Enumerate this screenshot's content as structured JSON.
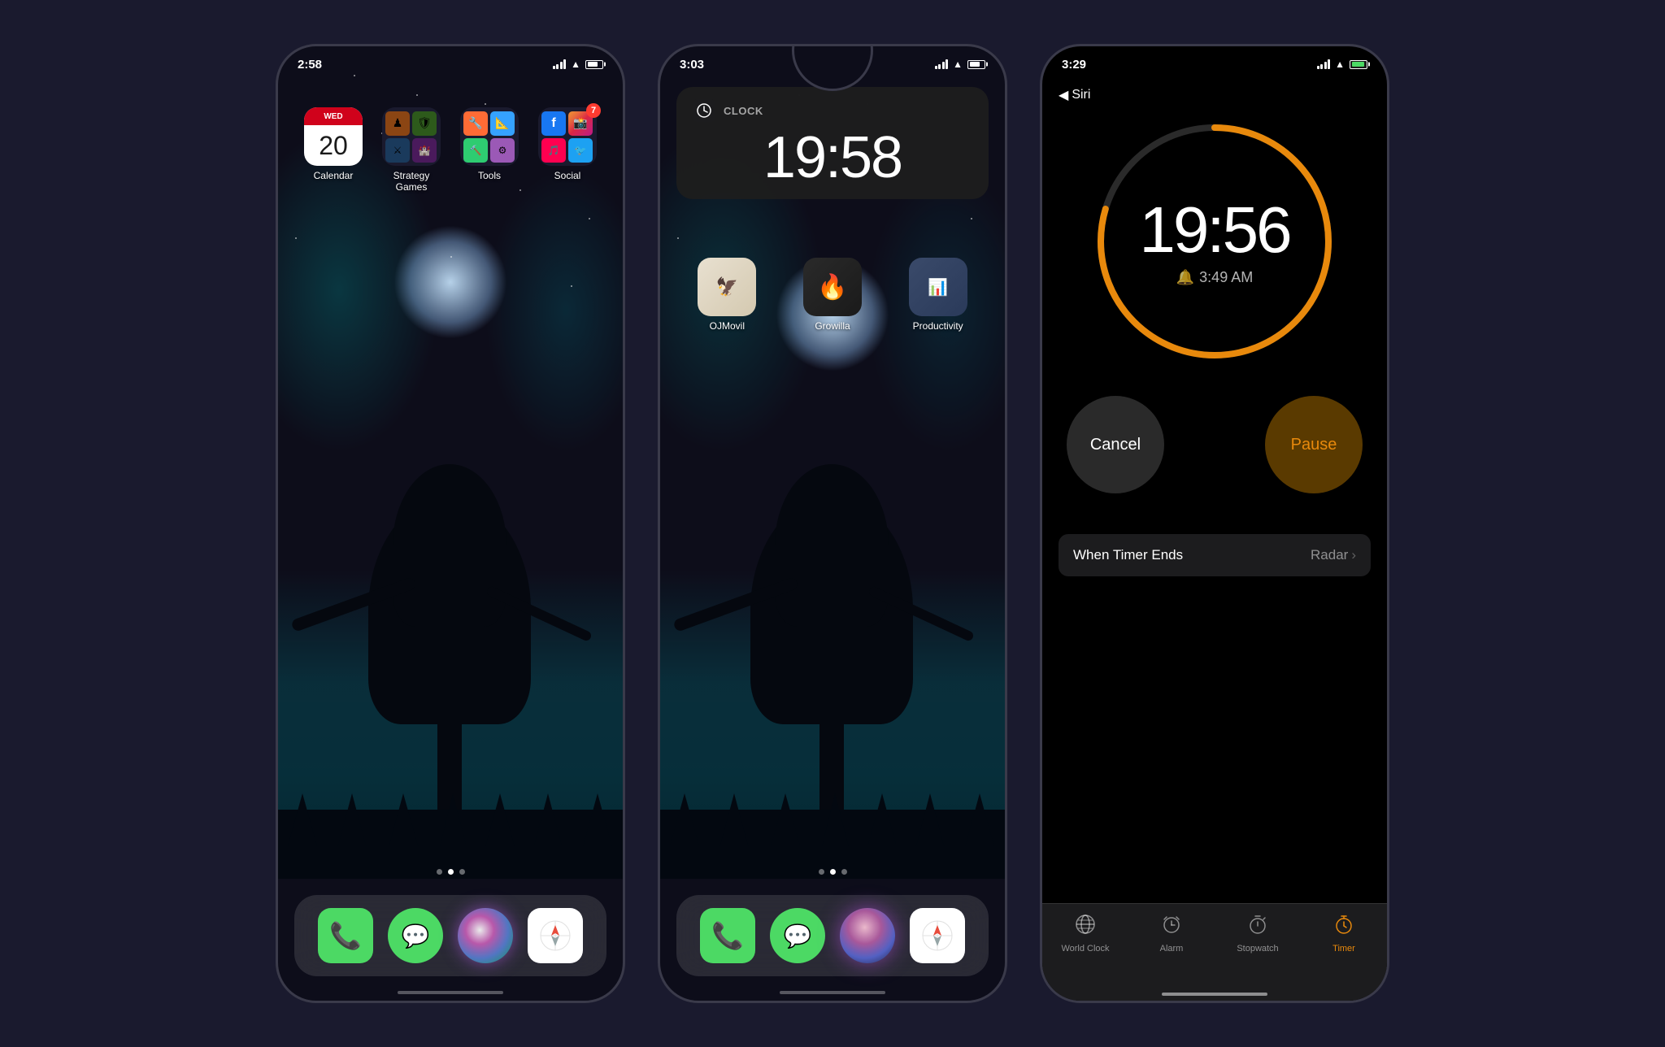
{
  "phone1": {
    "status_time": "2:58",
    "apps": [
      {
        "name": "Calendar",
        "date_day": "WED",
        "date_num": "20"
      },
      {
        "name": "Strategy Games"
      },
      {
        "name": "Tools"
      },
      {
        "name": "Social",
        "badge": "7"
      }
    ],
    "page_dots": 3,
    "active_dot": 1,
    "dock": [
      "Phone",
      "Messages",
      "Siri",
      "Safari"
    ]
  },
  "phone2": {
    "status_time": "3:03",
    "notification": {
      "app": "CLOCK",
      "time": "19:58"
    },
    "apps": [
      {
        "name": "OJMovil"
      },
      {
        "name": "Growilla"
      },
      {
        "name": "Productivity"
      }
    ],
    "page_dots": 3,
    "active_dot": 1,
    "dock": [
      "Phone",
      "Messages",
      "Siri",
      "Safari"
    ]
  },
  "phone3": {
    "status_time": "3:29",
    "back_label": "Siri",
    "timer": {
      "time": "19:56",
      "alarm": "3:49 AM",
      "cancel_label": "Cancel",
      "pause_label": "Pause"
    },
    "timer_ends": {
      "label": "When Timer Ends",
      "value": "Radar"
    },
    "tabs": [
      {
        "label": "World Clock",
        "icon": "🌐",
        "active": false
      },
      {
        "label": "Alarm",
        "icon": "🔔",
        "active": false
      },
      {
        "label": "Stopwatch",
        "icon": "⏱",
        "active": false
      },
      {
        "label": "Timer",
        "icon": "⏲",
        "active": true
      }
    ]
  }
}
